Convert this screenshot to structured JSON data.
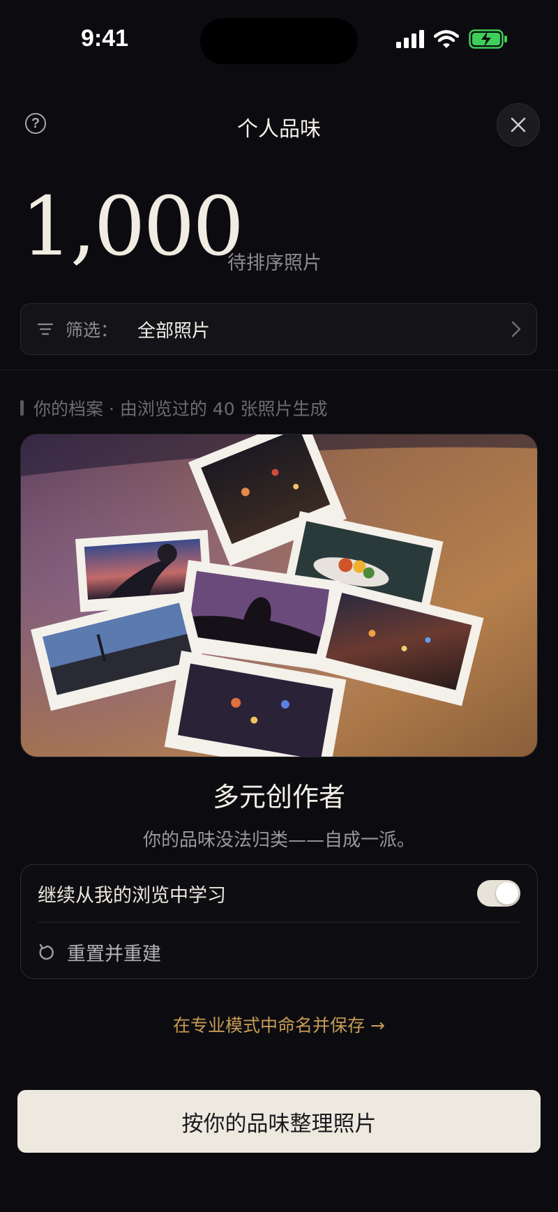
{
  "status": {
    "time": "9:41"
  },
  "header": {
    "title": "个人品味",
    "help_icon": "help-circle-icon",
    "close_icon": "close-icon"
  },
  "summary": {
    "count": "1,000",
    "count_label": "待排序照片"
  },
  "filter": {
    "label": "筛选：",
    "value": "全部照片"
  },
  "archive": {
    "text": "你的档案 · 由浏览过的 40 张照片生成"
  },
  "persona": {
    "title": "多元创作者",
    "description": "你的品味没法归类——自成一派。"
  },
  "settings": {
    "learn_label": "继续从我的浏览中学习",
    "learn_enabled": true,
    "reset_label": "重置并重建"
  },
  "pro_link": "在专业模式中命名并保存 →",
  "primary_button": "按你的品味整理照片",
  "colors": {
    "background": "#0c0c10",
    "accent": "#c79a55",
    "primary_button": "#eee9df",
    "battery": "#3ecf5a"
  }
}
